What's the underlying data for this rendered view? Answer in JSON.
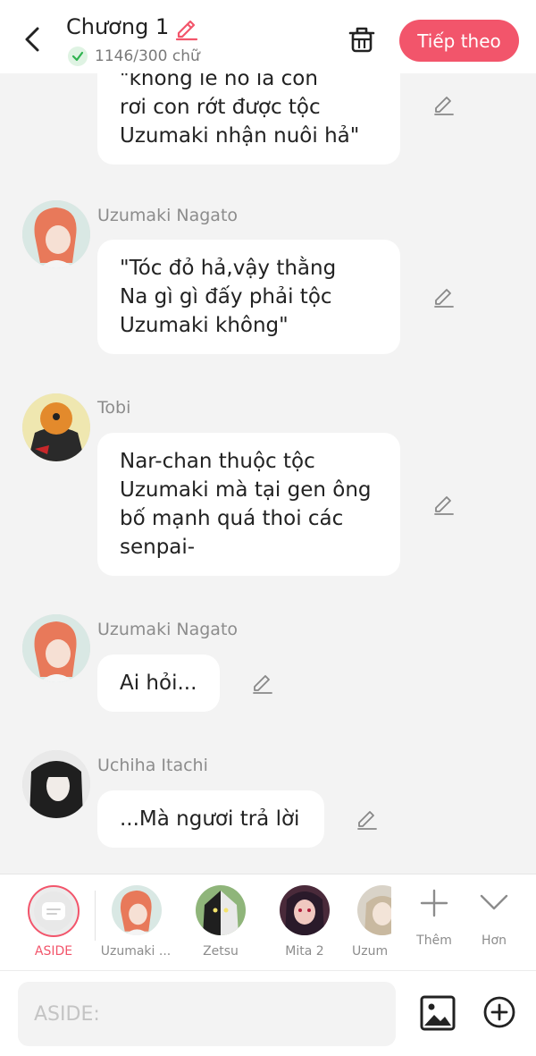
{
  "header": {
    "title": "Chương 1",
    "word_count": "1146/300 chữ",
    "next_label": "Tiếp theo",
    "accent_color": "#f2556b"
  },
  "messages": [
    {
      "sender": "",
      "lines": [
        "\"không lẽ nó là con",
        "rơi con rớt được tộc",
        "Uzumaki nhận nuôi hả\""
      ]
    },
    {
      "sender": "Uzumaki Nagato",
      "lines": [
        "\"Tóc đỏ hả,vậy thằng",
        "Na gì gì đấy phải tộc",
        "Uzumaki không\""
      ]
    },
    {
      "sender": "Tobi",
      "lines": [
        "Nar-chan thuộc tộc",
        "Uzumaki mà tại gen ông",
        "bố mạnh quá thoi các",
        "senpai-"
      ]
    },
    {
      "sender": "Uzumaki Nagato",
      "lines": [
        "Ai hỏi..."
      ]
    },
    {
      "sender": "Uchiha Itachi",
      "lines": [
        "...Mà ngươi trả lời"
      ]
    }
  ],
  "characters": [
    {
      "label": "ASIDE"
    },
    {
      "label": "Uzumaki ..."
    },
    {
      "label": "Zetsu"
    },
    {
      "label": "Mita 2"
    },
    {
      "label": "Uzum"
    },
    {
      "label": "Thêm"
    },
    {
      "label": "Hơn"
    }
  ],
  "input": {
    "placeholder": "ASIDE:"
  }
}
